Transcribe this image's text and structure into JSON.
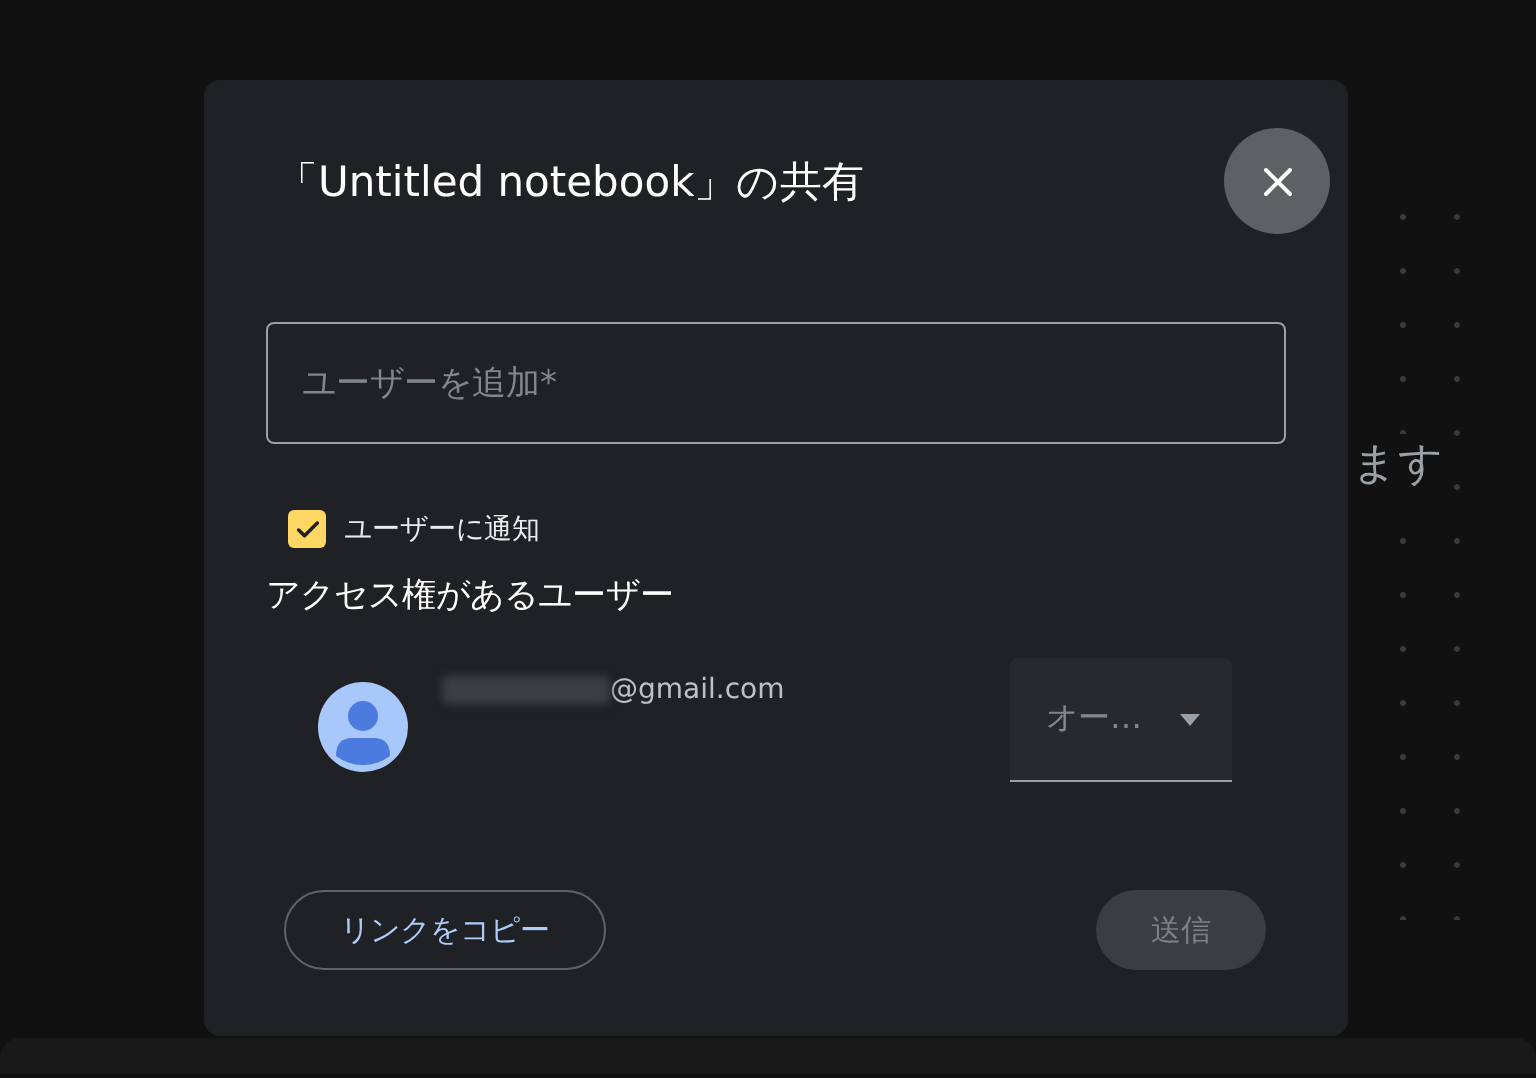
{
  "background": {
    "text": "ます"
  },
  "dialog": {
    "title": "「Untitled notebook」の共有",
    "add_user_field": {
      "placeholder": "ユーザーを追加*"
    },
    "notify_checkbox": {
      "label": "ユーザーに通知",
      "checked": true
    },
    "access_heading": "アクセス権があるユーザー",
    "users": [
      {
        "email": "@gmail.com",
        "email_redacted": true,
        "role": "オー…"
      }
    ],
    "copy_link_button": {
      "label": "リンクをコピー"
    },
    "send_button": {
      "label": "送信",
      "disabled": true
    }
  }
}
